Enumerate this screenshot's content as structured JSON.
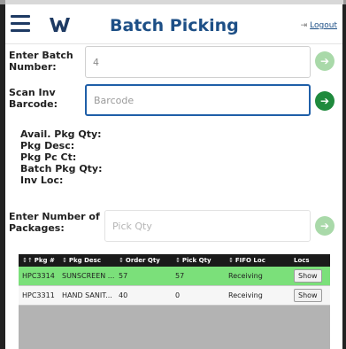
{
  "header": {
    "title": "Batch Picking",
    "logout_label": "Logout",
    "logout_icon": "logout-icon",
    "menu_icon": "hamburger-icon",
    "logo_icon": "app-logo",
    "title_color": "#1d4f86"
  },
  "form": {
    "batch": {
      "label_line1": "Enter Batch",
      "label_line2": "Number:",
      "value": "4"
    },
    "barcode": {
      "label_line1": "Scan Inv",
      "label_line2": "Barcode:",
      "placeholder": "Barcode"
    },
    "packages": {
      "label_line1": "Enter Number of",
      "label_line2": "Packages:",
      "placeholder": "Pick Qty"
    }
  },
  "info": {
    "avail": "Avail. Pkg Qty:",
    "desc": "Pkg Desc:",
    "pc": "Pkg Pc Ct:",
    "batch_qty": "Batch Pkg Qty:",
    "loc": "Inv Loc:"
  },
  "table": {
    "headers": [
      "Pkg #",
      "Pkg Desc",
      "Order Qty",
      "Pick Qty",
      "FIFO Loc",
      "Locs"
    ],
    "rows": [
      {
        "pkg": "HPC3314",
        "desc": "SUNSCREEN ...",
        "order_qty": "57",
        "pick_qty": "57",
        "fifo": "Receiving",
        "action": "Show",
        "selected": true
      },
      {
        "pkg": "HPC3311",
        "desc": "HAND SANIT...",
        "order_qty": "40",
        "pick_qty": "0",
        "fifo": "Receiving",
        "action": "Show",
        "selected": false
      }
    ]
  },
  "colors": {
    "accent": "#1f5fa8",
    "go_active": "#1f8a3d",
    "go_disabled": "#a9d9a9",
    "row_selected": "#7be07a"
  }
}
